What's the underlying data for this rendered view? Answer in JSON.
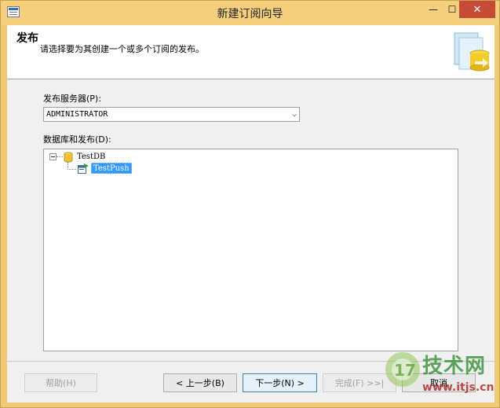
{
  "window": {
    "title": "新建订阅向导",
    "min_symbol": "—",
    "max_symbol": "☐",
    "close_symbol": "✕"
  },
  "header": {
    "title": "发布",
    "description": "请选择要为其创建一个或多个订阅的发布。"
  },
  "publisher": {
    "label": "发布服务器(P):",
    "value": "ADMINISTRATOR"
  },
  "tree": {
    "label": "数据库和发布(D):",
    "database": "TestDB",
    "publication": "TestPush"
  },
  "buttons": {
    "help": "帮助(H)",
    "back": "< 上一步(B)",
    "next": "下一步(N) >",
    "finish": "完成(F) >>|",
    "cancel": "取消"
  },
  "watermark": {
    "brand": "技术网",
    "url": "www.itjs.cn"
  },
  "icons": [
    "app-icon",
    "wizard-graphic-icon",
    "database-icon",
    "publication-icon",
    "tree-collapse-icon",
    "dropdown-arrow-icon",
    "watermark-logo-icon"
  ]
}
